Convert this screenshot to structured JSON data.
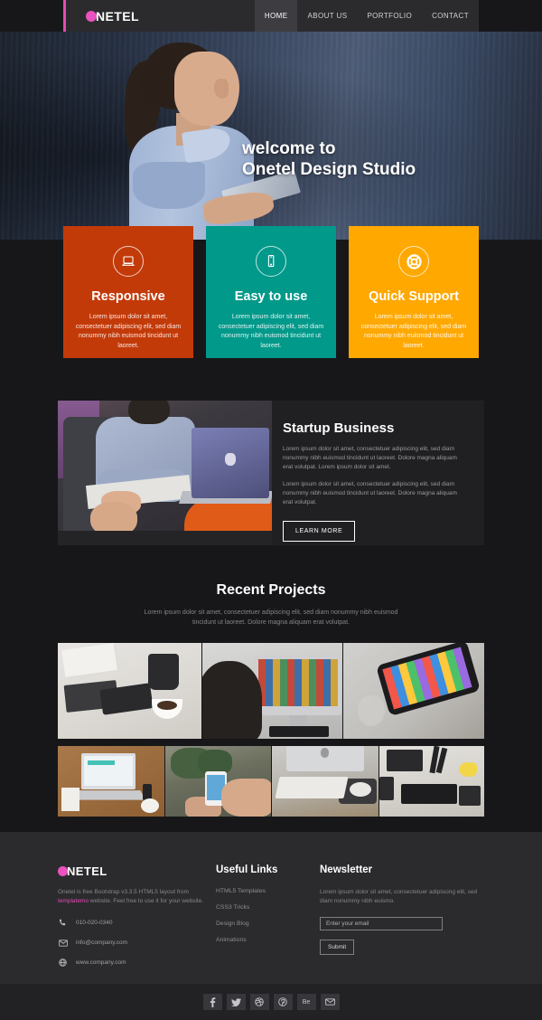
{
  "header": {
    "logo": {
      "mark": "circle-mark",
      "text": "NETEL"
    },
    "nav": [
      {
        "label": "HOME",
        "active": true
      },
      {
        "label": "ABOUT US",
        "active": false
      },
      {
        "label": "PORTFOLIO",
        "active": false
      },
      {
        "label": "CONTACT",
        "active": false
      }
    ]
  },
  "hero": {
    "line1": "welcome to",
    "line2": "Onetel Design Studio"
  },
  "features": [
    {
      "icon": "laptop-icon",
      "title": "Responsive",
      "desc": "Lorem ipsum dolor sit amet, consectetuer adipiscing elit, sed diam nonummy nibh euismod tincidunt ut laoreet.",
      "color": "#c33a09"
    },
    {
      "icon": "mobile-icon",
      "title": "Easy to use",
      "desc": "Lorem ipsum dolor sit amet, consectetuer adipiscing elit, sed diam nonummy nibh euismod tincidunt ut laoreet.",
      "color": "#00998a"
    },
    {
      "icon": "lifering-icon",
      "title": "Quick Support",
      "desc": "Lorem ipsum dolor sit amet, consectetuer adipiscing elit, sed diam nonummy nibh euismod tincidunt ut laoreet.",
      "color": "#ffa800"
    }
  ],
  "startup": {
    "title": "Startup Business",
    "paragraph1": "Lorem ipsum dolor sit amet, consectetuer adipiscing elit, sed diam nonummy nibh euismod tincidunt ut laoreet. Dolore magna aliquam erat volutpat. Lorem ipsum dolor sit amet.",
    "paragraph2": "Lorem ipsum dolor sit amet, consectetuer adipiscing elit, sed diam nonummy nibh euismod tincidunt ut laoreet. Dolore magna aliquam erat volutpat.",
    "button": "LEARN MORE"
  },
  "projects": {
    "title": "Recent Projects",
    "subtitle": "Lorem ipsum dolor sit amet, consectetuer adipiscing elit, sed diam nonummy nibh euismod tincidunt ut laoreet. Dolore magna aliquam erat volutpat."
  },
  "footer": {
    "logo": {
      "mark": "circle-mark",
      "text": "NETEL"
    },
    "description_pre": "Onetel is free Bootstrap v3.3.5 HTML5 layout from ",
    "description_link": "templatemo",
    "description_post": " website. Feel free to use it for your website.",
    "contacts": [
      {
        "icon": "phone-icon",
        "value": "010-020-0340"
      },
      {
        "icon": "envelope-icon",
        "value": "info@company.com"
      },
      {
        "icon": "globe-icon",
        "value": "www.company.com"
      }
    ],
    "useful_links": {
      "heading": "Useful Links",
      "items": [
        "HTML5 Templates",
        "CSS3 Tricks",
        "Design Blog",
        "Animations"
      ]
    },
    "newsletter": {
      "heading": "Newsletter",
      "text": "Lorem ipsum dolor sit amet, consectetuer adipiscing elit, sed diam nonummy nibh euismo.",
      "placeholder": "Enter your email",
      "input_value": "",
      "submit_label": "Submit"
    },
    "social": [
      {
        "icon": "facebook-icon",
        "glyph": "f"
      },
      {
        "icon": "twitter-icon",
        "glyph": "t"
      },
      {
        "icon": "dribbble-icon",
        "glyph": "d"
      },
      {
        "icon": "pinterest-icon",
        "glyph": "p"
      },
      {
        "icon": "behance-icon",
        "glyph": "Be"
      },
      {
        "icon": "email-icon",
        "glyph": "m"
      }
    ]
  },
  "colors": {
    "accent_pink": "#e54bb4",
    "orange": "#c33a09",
    "teal": "#00998a",
    "yellow": "#ffa800",
    "dark_bg": "#17171a",
    "footer_bg": "#2b2b2e"
  }
}
